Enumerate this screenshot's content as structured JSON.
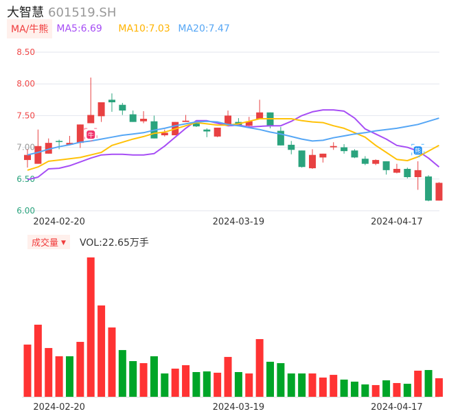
{
  "header": {
    "name": "大智慧",
    "code": "601519.SH"
  },
  "legend": {
    "badge": "MA/牛熊",
    "ma5": "MA5:6.69",
    "ma10": "MA10:7.03",
    "ma20": "MA20:7.47"
  },
  "volume_legend": {
    "badge": "成交量",
    "caret": "▼",
    "value": "VOL:22.65万手"
  },
  "signals": {
    "bull": "牛",
    "bear": "熊"
  },
  "colors": {
    "up": "#e84142",
    "down": "#2aa37d",
    "vol_up": "#ff3333",
    "vol_down": "#00a528",
    "ma5": "#a64df5",
    "ma10": "#ffc107",
    "ma20": "#55a6f5",
    "grid": "#e3e6ee"
  },
  "chart_data": [
    {
      "type": "candlestick",
      "title": "大智慧 601519.SH",
      "ylim": [
        6.0,
        8.5
      ],
      "yticks": [
        {
          "label": "8.50",
          "value": 8.5,
          "tone": "up"
        },
        {
          "label": "8.00",
          "value": 8.0,
          "tone": "up"
        },
        {
          "label": "7.50",
          "value": 7.5,
          "tone": "up"
        },
        {
          "label": "7.00",
          "value": 7.0,
          "tone": "flat"
        },
        {
          "label": "6.50",
          "value": 6.5,
          "tone": "down"
        },
        {
          "label": "6.00",
          "value": 6.0,
          "tone": "down"
        }
      ],
      "xticks": [
        {
          "label": "2024-02-20",
          "index": 3
        },
        {
          "label": "2024-03-19",
          "index": 20
        },
        {
          "label": "2024-04-17",
          "index": 35
        }
      ],
      "ohlc_order": [
        "open",
        "high",
        "low",
        "close"
      ],
      "candles": [
        [
          6.8,
          6.97,
          6.68,
          6.88
        ],
        [
          6.74,
          7.28,
          6.74,
          7.02
        ],
        [
          6.9,
          7.14,
          6.9,
          7.07
        ],
        [
          7.1,
          7.12,
          6.97,
          7.09
        ],
        [
          7.04,
          7.18,
          7.04,
          7.07
        ],
        [
          7.07,
          7.36,
          6.99,
          7.36
        ],
        [
          7.38,
          8.1,
          7.38,
          7.51
        ],
        [
          7.49,
          7.71,
          7.4,
          7.71
        ],
        [
          7.75,
          7.85,
          7.56,
          7.71
        ],
        [
          7.67,
          7.7,
          7.51,
          7.58
        ],
        [
          7.52,
          7.58,
          7.4,
          7.4
        ],
        [
          7.41,
          7.57,
          7.38,
          7.45
        ],
        [
          7.41,
          7.5,
          7.14,
          7.14
        ],
        [
          7.19,
          7.28,
          7.17,
          7.23
        ],
        [
          7.19,
          7.4,
          7.19,
          7.4
        ],
        [
          7.4,
          7.51,
          7.4,
          7.42
        ],
        [
          7.39,
          7.42,
          7.32,
          7.33
        ],
        [
          7.28,
          7.3,
          7.16,
          7.25
        ],
        [
          7.17,
          7.31,
          7.16,
          7.31
        ],
        [
          7.35,
          7.58,
          7.34,
          7.5
        ],
        [
          7.4,
          7.46,
          7.35,
          7.35
        ],
        [
          7.34,
          7.48,
          7.33,
          7.41
        ],
        [
          7.45,
          7.75,
          7.45,
          7.55
        ],
        [
          7.55,
          7.55,
          7.3,
          7.34
        ],
        [
          7.26,
          7.32,
          7.03,
          7.03
        ],
        [
          7.04,
          7.1,
          6.89,
          6.96
        ],
        [
          6.95,
          6.95,
          6.68,
          6.69
        ],
        [
          6.67,
          6.97,
          6.66,
          6.88
        ],
        [
          6.84,
          6.9,
          6.76,
          6.9
        ],
        [
          7.0,
          7.08,
          6.96,
          7.02
        ],
        [
          7.0,
          7.05,
          6.9,
          6.94
        ],
        [
          6.95,
          6.97,
          6.83,
          6.84
        ],
        [
          6.82,
          6.86,
          6.72,
          6.74
        ],
        [
          6.74,
          6.81,
          6.72,
          6.8
        ],
        [
          6.78,
          6.78,
          6.57,
          6.64
        ],
        [
          6.6,
          6.74,
          6.59,
          6.66
        ],
        [
          6.66,
          6.68,
          6.51,
          6.53
        ],
        [
          6.53,
          6.78,
          6.33,
          6.64
        ],
        [
          6.54,
          6.56,
          6.15,
          6.16
        ],
        [
          6.16,
          6.45,
          6.16,
          6.44
        ]
      ],
      "series": [
        {
          "name": "MA5",
          "values": [
            6.49,
            6.53,
            6.66,
            6.67,
            6.71,
            6.77,
            6.83,
            6.88,
            6.89,
            6.89,
            6.88,
            6.88,
            6.9,
            7.02,
            7.16,
            7.3,
            7.42,
            7.42,
            7.38,
            7.34,
            7.35,
            7.32,
            7.33,
            7.34,
            7.34,
            7.41,
            7.5,
            7.56,
            7.59,
            7.59,
            7.57,
            7.46,
            7.29,
            7.21,
            7.13,
            7.03,
            7.0,
            6.94,
            6.83,
            6.69
          ]
        },
        {
          "name": "MA10",
          "values": [
            6.64,
            6.69,
            6.78,
            6.8,
            6.82,
            6.84,
            6.88,
            6.92,
            7.03,
            7.08,
            7.13,
            7.17,
            7.22,
            7.24,
            7.29,
            7.34,
            7.39,
            7.37,
            7.35,
            7.35,
            7.37,
            7.41,
            7.45,
            7.45,
            7.45,
            7.45,
            7.42,
            7.4,
            7.39,
            7.34,
            7.3,
            7.23,
            7.16,
            7.03,
            6.92,
            6.81,
            6.79,
            6.85,
            6.94,
            7.03
          ]
        },
        {
          "name": "MA20",
          "values": [
            6.88,
            6.92,
            6.97,
            7.01,
            7.04,
            7.08,
            7.1,
            7.13,
            7.16,
            7.19,
            7.21,
            7.23,
            7.27,
            7.3,
            7.34,
            7.37,
            7.4,
            7.41,
            7.4,
            7.36,
            7.34,
            7.31,
            7.28,
            7.24,
            7.21,
            7.17,
            7.13,
            7.1,
            7.11,
            7.15,
            7.18,
            7.21,
            7.23,
            7.26,
            7.28,
            7.3,
            7.33,
            7.36,
            7.41,
            7.46
          ]
        }
      ],
      "signal_marks": [
        {
          "type": "bull",
          "index": 6,
          "price": 7.2
        },
        {
          "type": "bear",
          "index": 37,
          "price": 6.95
        }
      ]
    },
    {
      "type": "bar",
      "title": "成交量",
      "unit": "万手",
      "values": [
        63.8,
        88.1,
        59.6,
        49.5,
        49.5,
        67.1,
        170.3,
        111.6,
        84.7,
        57.1,
        43.6,
        41.1,
        49.5,
        28.5,
        34.4,
        38.6,
        30.2,
        31.0,
        29.4,
        48.7,
        30.2,
        28.5,
        70.5,
        42.8,
        41.1,
        28.5,
        28.5,
        28.5,
        23.5,
        26.8,
        21.0,
        18.5,
        15.1,
        14.3,
        20.1,
        16.8,
        15.9,
        31.9,
        32.7,
        22.65
      ],
      "direction": [
        "up",
        "up",
        "up",
        "up",
        "down",
        "up",
        "up",
        "up",
        "up",
        "down",
        "down",
        "up",
        "down",
        "down",
        "up",
        "up",
        "down",
        "down",
        "up",
        "up",
        "down",
        "up",
        "up",
        "down",
        "down",
        "down",
        "down",
        "up",
        "up",
        "up",
        "down",
        "down",
        "down",
        "up",
        "down",
        "up",
        "down",
        "up",
        "down",
        "up"
      ]
    }
  ]
}
